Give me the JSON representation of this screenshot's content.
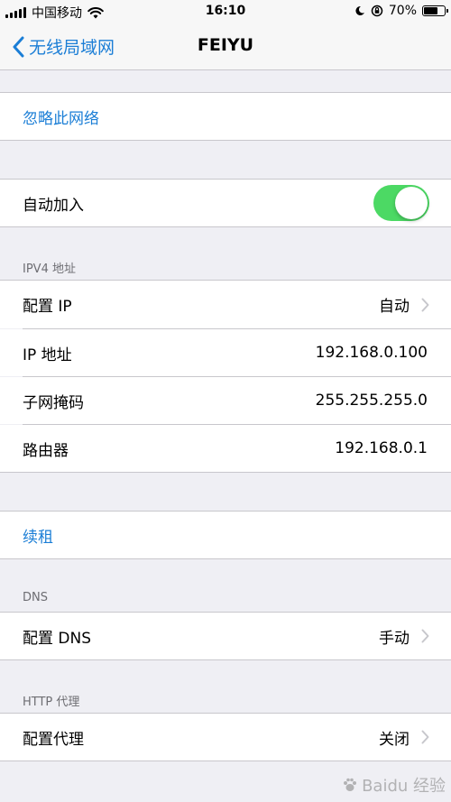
{
  "status": {
    "carrier": "中国移动",
    "time": "16:10",
    "battery": "70%",
    "battery_level": 0.7
  },
  "nav": {
    "back_label": "无线局域网",
    "title": "FEIYU"
  },
  "forget": "忽略此网络",
  "auto_join": {
    "label": "自动加入",
    "on": true
  },
  "ipv4": {
    "header": "IPV4 地址",
    "rows": [
      {
        "label": "配置 IP",
        "value": "自动"
      },
      {
        "label": "IP 地址",
        "value": "192.168.0.100"
      },
      {
        "label": "子网掩码",
        "value": "255.255.255.0"
      },
      {
        "label": "路由器",
        "value": "192.168.0.1"
      }
    ]
  },
  "renew": "续租",
  "dns": {
    "header": "DNS",
    "label": "配置 DNS",
    "value": "手动"
  },
  "proxy": {
    "header": "HTTP 代理",
    "label": "配置代理",
    "value": "关闭"
  },
  "watermark": "Baidu 经验",
  "colors": {
    "accent": "#1b7ed6",
    "toggle_on": "#4cd964",
    "background": "#efeff4"
  },
  "icons": [
    "signal-icon",
    "wifi-icon",
    "moon-icon",
    "rotation-lock-icon",
    "battery-icon",
    "chevron-left-icon",
    "chevron-right-icon"
  ]
}
